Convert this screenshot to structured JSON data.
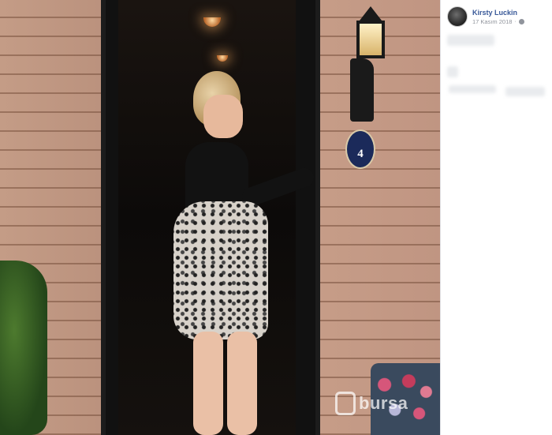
{
  "post": {
    "author": "Kirsty Luckin",
    "date": "17 Kasım 2018",
    "separator": "·",
    "privacy_icon": "globe-icon"
  },
  "photo": {
    "house_number": "4",
    "watermark": "bursa"
  }
}
